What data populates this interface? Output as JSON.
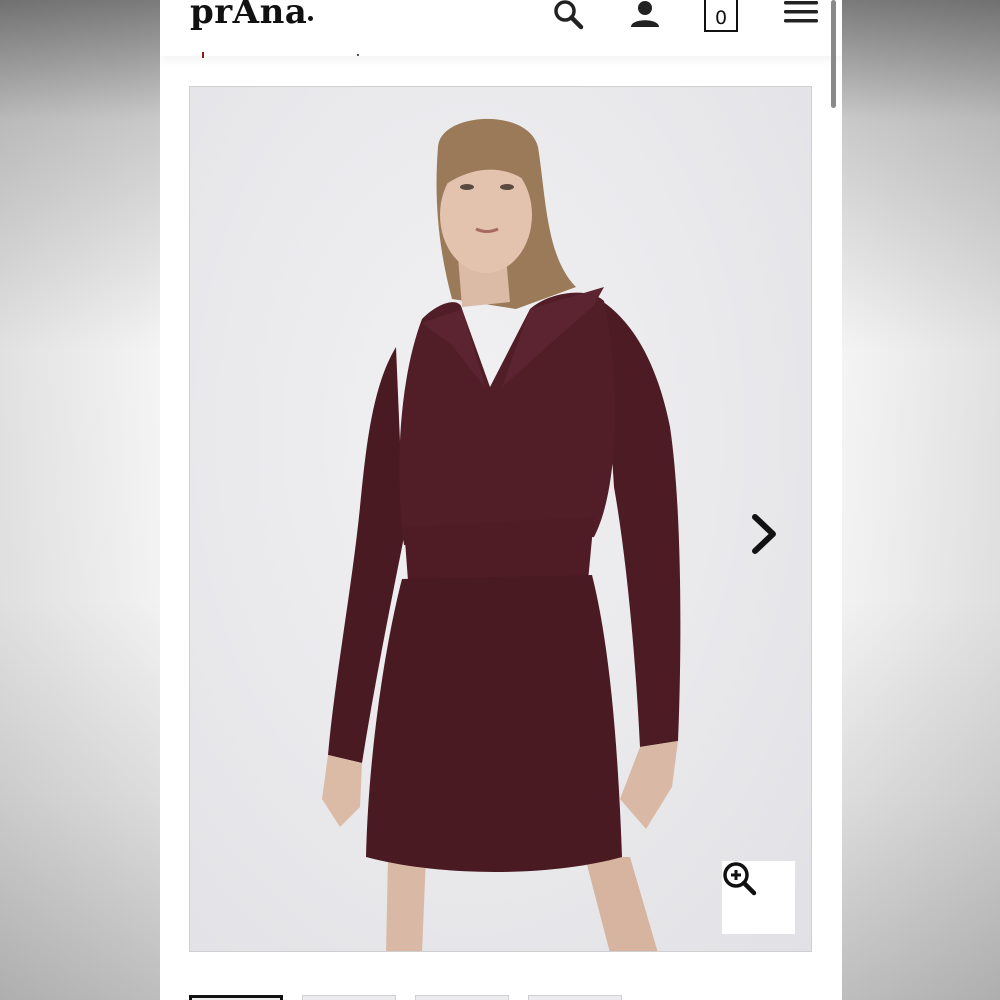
{
  "header": {
    "logo_text": "prAna",
    "icons": [
      "search-icon",
      "account-icon",
      "cart-icon",
      "menu-icon"
    ],
    "cart_count": "0"
  },
  "gallery": {
    "current_index": 0,
    "thumbnail_count": 4,
    "controls": [
      "next-arrow-icon",
      "zoom-in-icon"
    ]
  },
  "colors": {
    "brand_text": "#111111",
    "accent": "#8b1d1d",
    "product": "#4a1a22"
  }
}
